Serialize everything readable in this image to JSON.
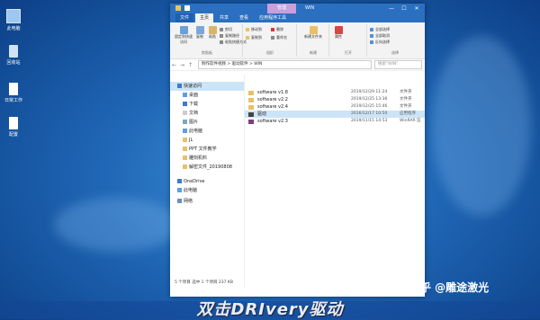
{
  "desktop": {
    "icons": [
      {
        "label": "此电脑",
        "icon": "computer-icon"
      },
      {
        "label": "回收站",
        "icon": "recycle-bin-icon"
      },
      {
        "label": "日常工作",
        "icon": "document-icon"
      },
      {
        "label": "配置",
        "icon": "document-icon"
      }
    ]
  },
  "window": {
    "context_tab": "管理",
    "title": "WIN",
    "controls": [
      "—",
      "☐",
      "✕"
    ],
    "tabs": [
      "文件",
      "主页",
      "共享",
      "查看",
      "应用程序工具"
    ],
    "ribbon": {
      "clipboard": {
        "pin": "固定到快速访问",
        "copy": "复制",
        "paste": "粘贴",
        "cut": "剪切",
        "copy_path": "复制路径",
        "paste_shortcut": "粘贴快捷方式",
        "group": "剪贴板"
      },
      "organize": {
        "move_to": "移动到",
        "copy_to": "复制到",
        "delete": "删除",
        "rename": "重命名",
        "group": "组织"
      },
      "new": {
        "new_folder": "新建文件夹",
        "group": "新建"
      },
      "open": {
        "properties": "属性",
        "group": "打开"
      },
      "select": {
        "all": "全部选择",
        "none": "全部取消",
        "invert": "反向选择",
        "group": "选择"
      }
    },
    "address": {
      "path": "制作软件视频 > 驱动软件 > WIN",
      "search_placeholder": "搜索\"WIN\""
    },
    "nav": [
      {
        "label": "快速访问",
        "icon": "star-icon",
        "top": true,
        "selected": true
      },
      {
        "label": "桌面",
        "icon": "desktop-icon"
      },
      {
        "label": "下载",
        "icon": "download-icon"
      },
      {
        "label": "文档",
        "icon": "document-icon"
      },
      {
        "label": "图片",
        "icon": "picture-icon"
      },
      {
        "label": "此电脑",
        "icon": "computer-icon"
      },
      {
        "label": "JL",
        "icon": "folder-icon"
      },
      {
        "label": "PPT 文件教学",
        "icon": "folder-icon"
      },
      {
        "label": "雕刻机料",
        "icon": "folder-icon"
      },
      {
        "label": "解密文件_20190808",
        "icon": "folder-icon"
      },
      {
        "label": "OneDrive",
        "icon": "cloud-icon",
        "top": true
      },
      {
        "label": "此电脑",
        "icon": "computer-icon",
        "top": true
      },
      {
        "label": "网络",
        "icon": "network-icon",
        "top": true
      }
    ],
    "files": [
      {
        "name": "software v1.8",
        "date": "2019/12/29 11:24",
        "type": "文件夹",
        "icon": "folder-icon"
      },
      {
        "name": "software v2.2",
        "date": "2019/12/25 13:36",
        "type": "文件夹",
        "icon": "folder-icon"
      },
      {
        "name": "software v2.4",
        "date": "2019/12/25 15:46",
        "type": "文件夹",
        "icon": "folder-icon"
      },
      {
        "name": "驱动",
        "date": "2016/12/17 10:50",
        "type": "应用程序",
        "icon": "app-icon",
        "selected": true
      },
      {
        "name": "software v2.3",
        "date": "2019/11/15 14:53",
        "type": "WinRAR 压",
        "icon": "rar-icon"
      }
    ],
    "status": "5 个项目    选中 1 个项目  237 KB"
  },
  "overlay": {
    "subtitle": "双击DRIvery驱动",
    "watermark": "知乎 @雕途激光"
  },
  "colors": {
    "title_blue": "#2b6fc0",
    "selection": "#cce4f7",
    "folder": "#e8c06a"
  }
}
